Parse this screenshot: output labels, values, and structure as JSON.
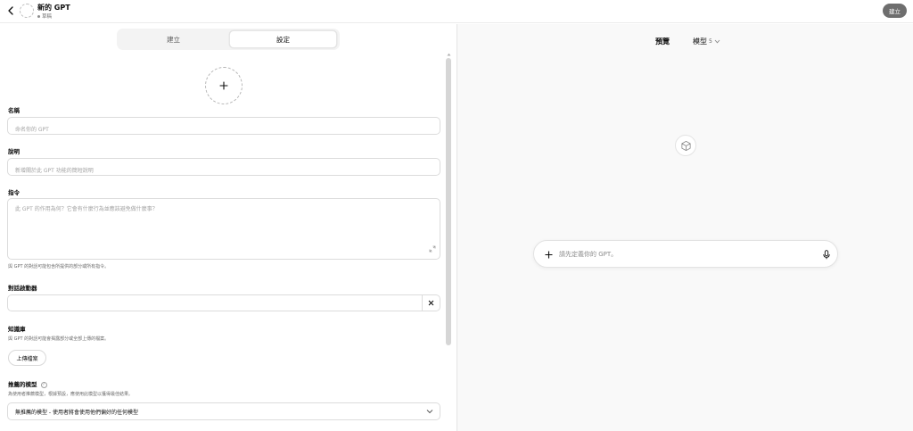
{
  "header": {
    "title": "新的 GPT",
    "status": "草稿",
    "create_label": "建立"
  },
  "tabs": [
    {
      "label": "建立"
    },
    {
      "label": "設定"
    }
  ],
  "form": {
    "name": {
      "label": "名稱",
      "placeholder": "命名你的 GPT",
      "value": ""
    },
    "description": {
      "label": "說明",
      "placeholder": "新增關於此 GPT 功能的簡短說明",
      "value": ""
    },
    "instructions": {
      "label": "指令",
      "placeholder": "此 GPT 的作用為何？它會有什麼行為並應該避免做什麼事？",
      "value": "",
      "hint": "與 GPT 的對話可能包含所提供的部分或所有指令。"
    },
    "conversation_starters": {
      "label": "對話啟動器",
      "value": ""
    },
    "knowledge": {
      "label": "知識庫",
      "hint": "與 GPT 的對話可能會揭露部分或全部上傳的檔案。",
      "upload_label": "上傳檔案"
    },
    "recommended_model": {
      "label": "推薦的模型",
      "help": "?",
      "hint": "為使用者推薦模型，根據預設，應使用此模型以獲得最佳結果。",
      "selected": "無推薦的模型 - 使用者將會使用他們偏好的任何模型"
    }
  },
  "preview": {
    "title": "預覽",
    "model_label": "模型",
    "model_version": "5",
    "composer_placeholder": "請先定義你的 GPT。"
  },
  "icons": {
    "back": "chevron-left-icon",
    "avatar_upload": "plus-icon",
    "clear": "close-icon",
    "dropdown": "chevron-down-icon",
    "placeholder_logo": "cube-icon",
    "attach": "plus-icon",
    "voice": "microphone-icon"
  }
}
